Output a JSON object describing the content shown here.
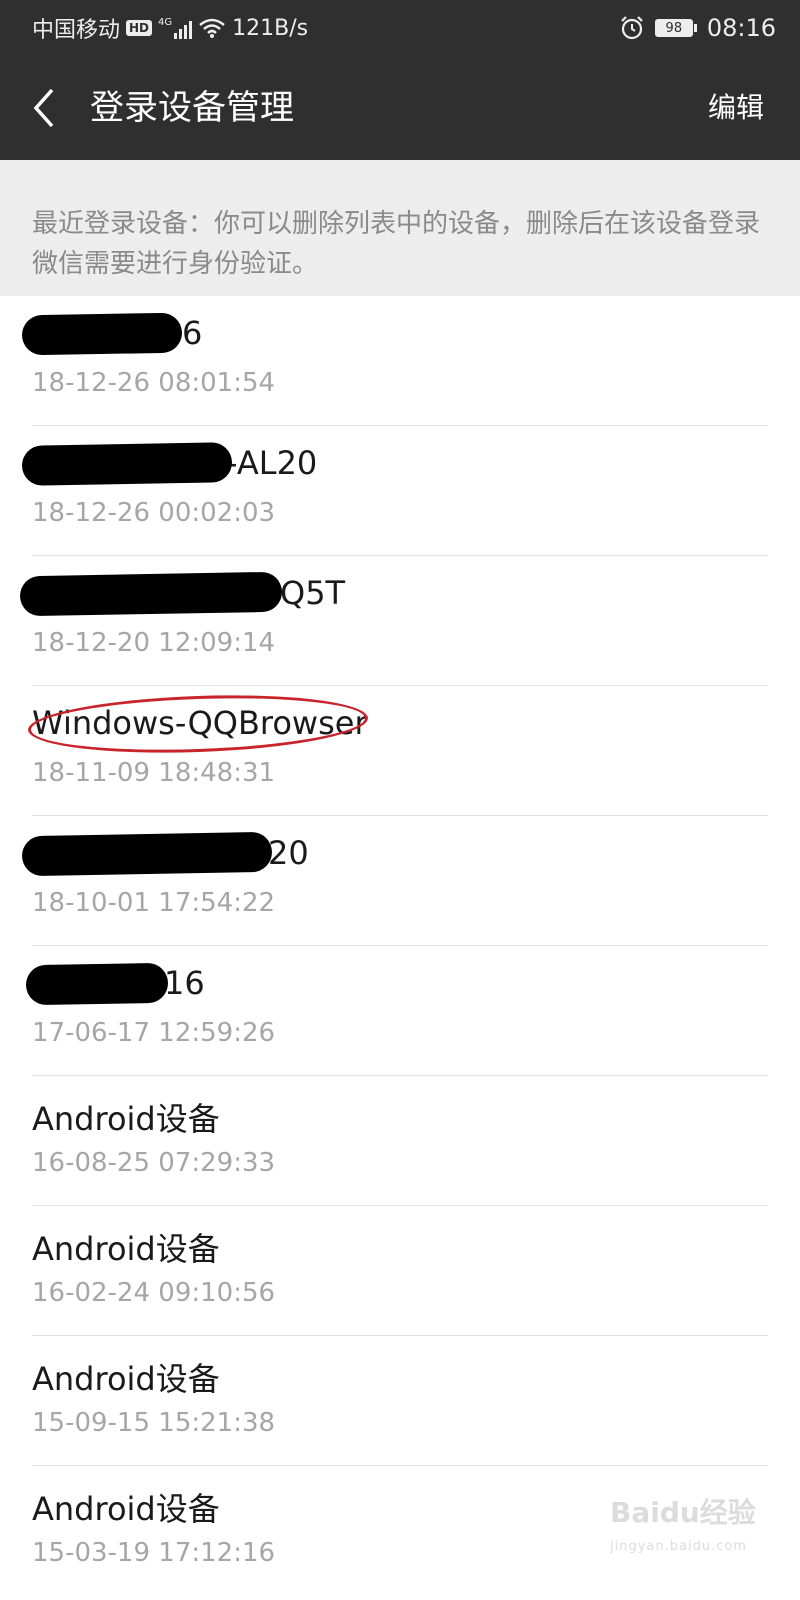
{
  "status_bar": {
    "carrier": "中国移动",
    "hd": "HD",
    "network": "4G",
    "speed": "121B/s",
    "battery": "98",
    "time": "08:16"
  },
  "nav": {
    "title": "登录设备管理",
    "edit_label": "编辑"
  },
  "notice": {
    "text": "最近登录设备：你可以删除列表中的设备，删除后在该设备登录微信需要进行身份验证。"
  },
  "devices": [
    {
      "name": "6",
      "time": "18-12-26 08:01:54"
    },
    {
      "name": "-AL20",
      "time": "18-12-26 00:02:03"
    },
    {
      "name": "Q5T",
      "time": "18-12-20 12:09:14"
    },
    {
      "name": "Windows-QQBrowser",
      "time": "18-11-09 18:48:31"
    },
    {
      "name": "20",
      "time": "18-10-01 17:54:22"
    },
    {
      "name": "16",
      "time": "17-06-17 12:59:26"
    },
    {
      "name": "Android设备",
      "time": "16-08-25 07:29:33"
    },
    {
      "name": "Android设备",
      "time": "16-02-24 09:10:56"
    },
    {
      "name": "Android设备",
      "time": "15-09-15 15:21:38"
    },
    {
      "name": "Android设备",
      "time": "15-03-19 17:12:16"
    }
  ],
  "watermark": {
    "main": "Baidu经验",
    "sub": "jingyan.baidu.com"
  },
  "colors": {
    "header_bg": "#2f2f2f",
    "notice_bg": "#ededed",
    "annotation": "#c8242b"
  }
}
